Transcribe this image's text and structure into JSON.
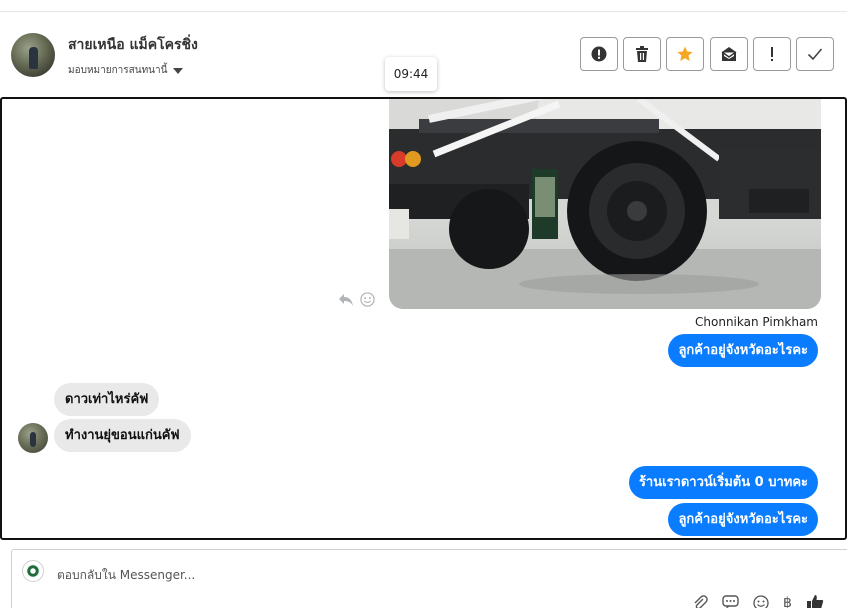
{
  "conversation": {
    "contact_name": "สายเหนือ แม็คโครชิ่ง",
    "assigned_label": "มอบหมายการสนทนานี้"
  },
  "toolbar": {
    "buttons": [
      {
        "name": "alert-circle",
        "icon": "exclamation-circle-icon"
      },
      {
        "name": "delete",
        "icon": "trash-icon"
      },
      {
        "name": "star",
        "icon": "star-icon",
        "color": "#f5a623"
      },
      {
        "name": "mark-read",
        "icon": "envelope-open-icon"
      },
      {
        "name": "spam",
        "icon": "exclamation-icon"
      },
      {
        "name": "done",
        "icon": "check-icon"
      }
    ]
  },
  "tooltip": {
    "time": "09:44"
  },
  "messages": {
    "sender_name": "Chonnikan Pimkham",
    "outgoing": [
      "ลูกค้าอยู่จังหวัดอะไรคะ",
      "ร้านเราดาวน์เริ่มต้น 0 บาทคะ",
      "ลูกค้าอยู่จังหวัดอะไรคะ"
    ],
    "incoming": [
      "ดาวเท่าไหร่คัฟ",
      "ทำงานยุ่ขอนแก่นคัฟ"
    ]
  },
  "composer": {
    "placeholder": "ตอบกลับใน Messenger...",
    "tools": [
      "paperclip-icon",
      "saved-reply-icon",
      "emoji-icon",
      "baht-icon",
      "thumbs-up-icon"
    ]
  },
  "colors": {
    "outgoing_bubble": "#0a7cff",
    "incoming_bubble": "#e9e9e9",
    "star": "#f5a623"
  }
}
